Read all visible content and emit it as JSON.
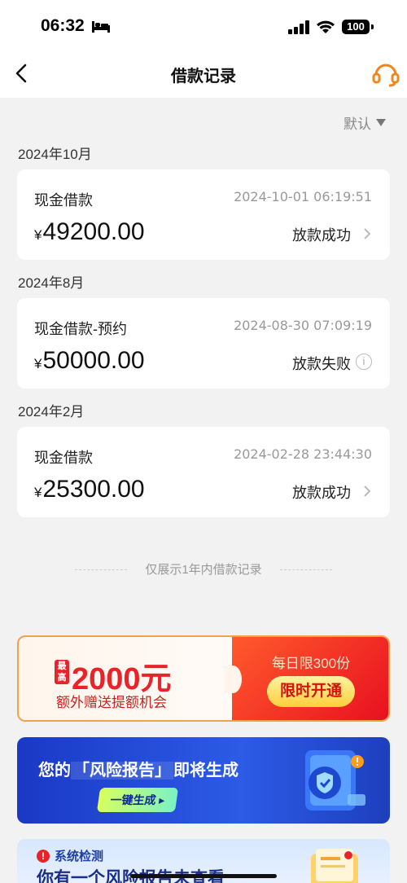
{
  "status_bar": {
    "time": "06:32",
    "battery": "100"
  },
  "nav": {
    "title": "借款记录"
  },
  "sort": {
    "label": "默认"
  },
  "records": [
    {
      "month": "2024年10月",
      "type": "现金借款",
      "time": "2024-10-01 06:19:51",
      "amount": "49200.00",
      "currency": "¥",
      "status": "放款成功"
    },
    {
      "month": "2024年8月",
      "type": "现金借款-预约",
      "time": "2024-08-30 07:09:19",
      "amount": "50000.00",
      "currency": "¥",
      "status": "放款失败"
    },
    {
      "month": "2024年2月",
      "type": "现金借款",
      "time": "2024-02-28 23:44:30",
      "amount": "25300.00",
      "currency": "¥",
      "status": "放款成功"
    }
  ],
  "notice": "仅展示1年内借款记录",
  "promo": {
    "tag": "最高",
    "amount": "2000元",
    "subtitle": "额外赠送提额机会",
    "limit": "每日限300份",
    "button": "限时开通"
  },
  "risk_banner": {
    "title_prefix": "您的",
    "title_highlight": "「风险报告」",
    "title_suffix": "即将生成",
    "button": "一键生成 ▸"
  },
  "check_banner": {
    "tag": "系统检测",
    "title": "你有一个风险报告未查看"
  }
}
